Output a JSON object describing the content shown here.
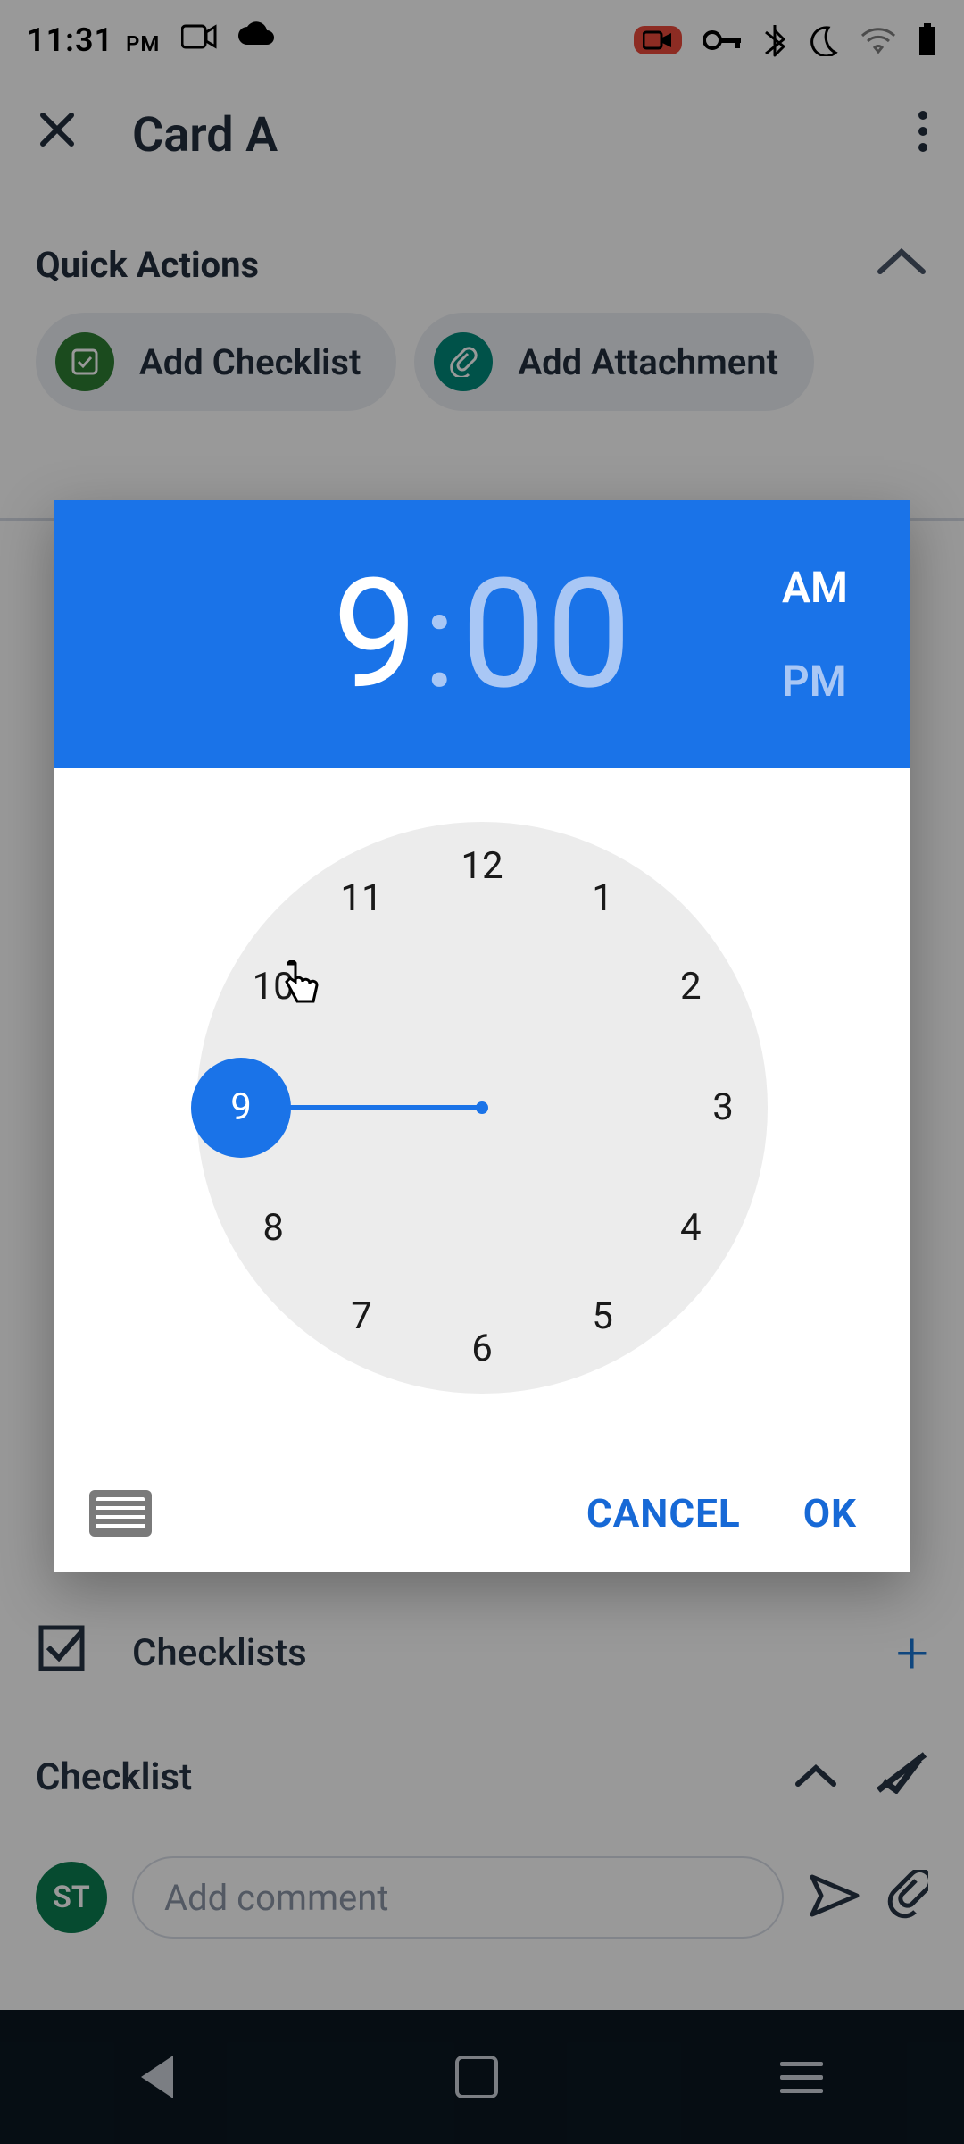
{
  "status_bar": {
    "time": "11:31",
    "time_suffix": "PM",
    "left_icons": [
      "camera-icon",
      "cloud-sync-icon"
    ],
    "right_icons": [
      "record-icon",
      "key-vpn-icon",
      "bluetooth-icon",
      "moon-dnd-icon",
      "wifi-icon",
      "battery-icon"
    ]
  },
  "card": {
    "title": "Card A",
    "quick_actions_label": "Quick Actions",
    "actions": {
      "checklist_label": "Add Checklist",
      "attachment_label": "Add Attachment"
    },
    "checklists_label": "Checklists",
    "checklist_name": "Checklist",
    "comment_placeholder": "Add comment",
    "avatar_initials": "ST"
  },
  "time_picker": {
    "hour": "9",
    "minute": "00",
    "am_label": "AM",
    "pm_label": "PM",
    "selected_period": "AM",
    "selected_hour": 9,
    "hours": [
      "12",
      "1",
      "2",
      "3",
      "4",
      "5",
      "6",
      "7",
      "8",
      "9",
      "10",
      "11"
    ],
    "cancel_label": "CANCEL",
    "ok_label": "OK"
  }
}
